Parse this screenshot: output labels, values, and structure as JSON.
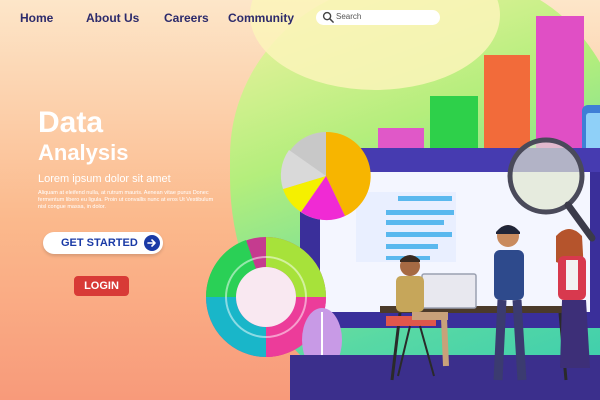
{
  "nav": {
    "home": "Home",
    "about": "About Us",
    "careers": "Careers",
    "community": "Community"
  },
  "search": {
    "placeholder": "Search"
  },
  "hero": {
    "title_line1": "Data",
    "title_line2": "Analysis",
    "subtitle": "Lorem ipsum dolor sit amet",
    "body": "Aliquam at eleifend nulla, at rutrum mauris. Aenean vitae purus Donec fermentum libero eu ligula. Proin ut convallis nunc at eros Ut Vestibulum nisl congue massa, in dolor."
  },
  "buttons": {
    "get_started": "GET STARTED",
    "login": "LOGIN"
  },
  "icons": {
    "search": "search-icon",
    "arrow": "arrow-right-icon"
  },
  "colors": {
    "nav_text": "#2c2a6b",
    "button_text": "#1a3aa6",
    "login_bg": "#d83a36"
  }
}
